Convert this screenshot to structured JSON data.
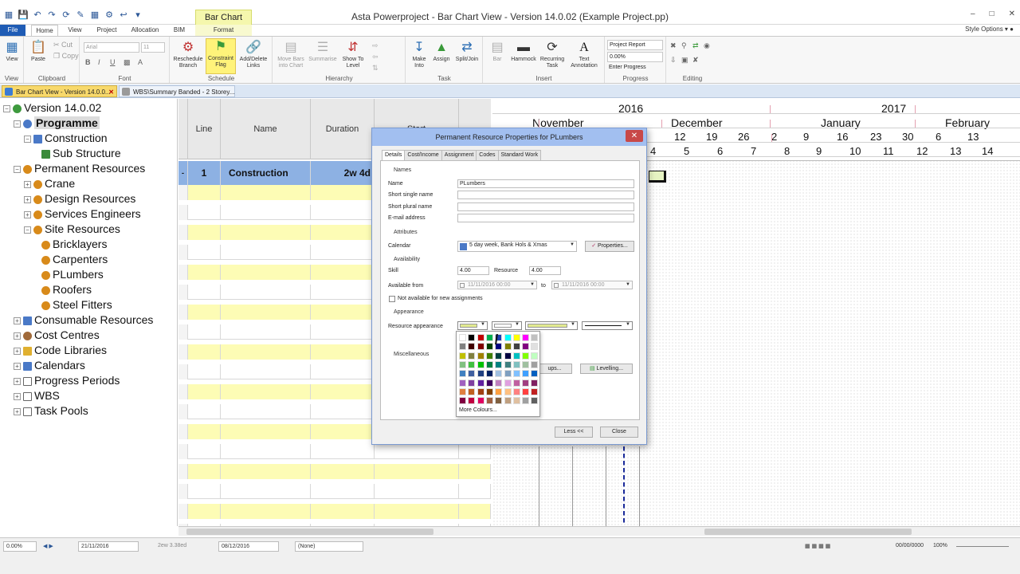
{
  "window": {
    "title": "Asta Powerproject - Bar Chart View - Version 14.0.02 (Example Project.pp)",
    "context_tools": "Bar Chart Tools",
    "controls": [
      "–",
      "□",
      "✕"
    ]
  },
  "ribbon_tabs": [
    "File",
    "Home",
    "View",
    "Project",
    "Allocation",
    "BIM",
    "Format"
  ],
  "style_options": "Style Options",
  "ribbon": {
    "view": {
      "btn": "View",
      "group": "View"
    },
    "clipboard": {
      "paste": "Paste",
      "cut": "Cut",
      "copy": "Copy",
      "group": "Clipboard"
    },
    "font": {
      "family": "Arial",
      "size": "11",
      "group": "Font",
      "bold": "B",
      "italic": "I",
      "underline": "U"
    },
    "schedule": {
      "reschedule": "Reschedule Branch",
      "constraint": "Constraint Flag",
      "add_delete": "Add/Delete Links",
      "group": "Schedule"
    },
    "hierarchy": {
      "move_bars": "Move Bars into Chart",
      "summarise": "Summarise",
      "show_to_level": "Show To Level",
      "group": "Hierarchy"
    },
    "task": {
      "make_into": "Make Into",
      "assign": "Assign",
      "split_join": "Split/Join",
      "group": "Task"
    },
    "insert": {
      "bar": "Bar",
      "hammock": "Hammock",
      "recurring": "Recurring Task",
      "text_annotation": "Text Annotation",
      "group": "Insert"
    },
    "progress": {
      "report": "Project Report",
      "percent": "0.00%",
      "enter": "Enter Progress",
      "group": "Progress"
    },
    "editing": {
      "group": "Editing"
    }
  },
  "doc_tabs": [
    {
      "label": "Bar Chart View - Version 14.0.0..."
    },
    {
      "label": "WBS\\Summary Banded - 2 Storey..."
    }
  ],
  "tree": [
    {
      "label": "Version 14.0.02",
      "icon": "globe-icon",
      "color": "#3e9a3e"
    },
    {
      "label": "Programme",
      "icon": "programme-icon",
      "color": "#4a79c7"
    },
    {
      "label": "Construction",
      "icon": "folder-icon",
      "color": "#4a79c7"
    },
    {
      "label": "Sub Structure",
      "icon": "chart-icon",
      "color": "#3a8a3a"
    },
    {
      "label": "Permanent Resources",
      "icon": "resource-icon",
      "color": "#d88a1a"
    },
    {
      "label": "Crane",
      "icon": "resource-icon",
      "color": "#d88a1a"
    },
    {
      "label": "Design Resources",
      "icon": "resource-icon",
      "color": "#d88a1a"
    },
    {
      "label": "Services Engineers",
      "icon": "resource-icon",
      "color": "#d88a1a"
    },
    {
      "label": "Site Resources",
      "icon": "resource-icon",
      "color": "#d88a1a"
    },
    {
      "label": "Bricklayers",
      "icon": "resource-icon",
      "color": "#d88a1a"
    },
    {
      "label": "Carpenters",
      "icon": "resource-icon",
      "color": "#d88a1a"
    },
    {
      "label": "PLumbers",
      "icon": "resource-icon",
      "color": "#d88a1a"
    },
    {
      "label": "Roofers",
      "icon": "resource-icon",
      "color": "#d88a1a"
    },
    {
      "label": "Steel Fitters",
      "icon": "resource-icon",
      "color": "#d88a1a"
    },
    {
      "label": "Consumable Resources",
      "icon": "consumable-icon",
      "color": "#4a79c7"
    },
    {
      "label": "Cost Centres",
      "icon": "cost-icon",
      "color": "#a06a3a"
    },
    {
      "label": "Code Libraries",
      "icon": "folder-icon",
      "color": "#e0b030"
    },
    {
      "label": "Calendars",
      "icon": "calendar-icon",
      "color": "#4a79c7"
    },
    {
      "label": "Progress Periods",
      "icon": "progress-icon",
      "color": "#666666"
    },
    {
      "label": "WBS",
      "icon": "wbs-icon",
      "color": "#666666"
    },
    {
      "label": "Task Pools",
      "icon": "pool-icon",
      "color": "#666666"
    }
  ],
  "grid": {
    "columns": [
      "Line",
      "Name",
      "Duration",
      "Start"
    ],
    "first_row": {
      "line": "1",
      "name": "Construction",
      "duration": "2w 4d"
    }
  },
  "gantt": {
    "years": [
      "2016",
      "2017"
    ],
    "months": [
      "November",
      "December",
      "January",
      "February"
    ],
    "days": [
      "12",
      "19",
      "26",
      "2",
      "9",
      "16",
      "23",
      "30",
      "6",
      "13"
    ],
    "weeks": [
      "4",
      "5",
      "6",
      "7",
      "8",
      "9",
      "10",
      "11",
      "12",
      "13",
      "14"
    ]
  },
  "dialog": {
    "title": "Permanent Resource Properties for PLumbers",
    "close": "✕",
    "tabs": [
      "Details",
      "Cost/Income",
      "Assignment",
      "Codes",
      "Standard Work"
    ],
    "names_section": "Names",
    "name_label": "Name",
    "name_value": "PLumbers",
    "short_single_label": "Short single name",
    "short_plural_label": "Short plural name",
    "email_label": "E-mail address",
    "attributes_section": "Attributes",
    "calendar_label": "Calendar",
    "calendar_value": "5 day week, Bank Hols & Xmas",
    "properties_btn": "Properties...",
    "availability_section": "Availability",
    "skill_label": "Skill",
    "skill_value": "4.00",
    "resource_label": "Resource",
    "resource_value": "4.00",
    "available_from_label": "Available from",
    "from_value": "11/11/2016 00:00",
    "to_label": "to",
    "to_value": "11/11/2016 00:00",
    "not_available_label": "Not available for new assignments",
    "appearance_section": "Appearance",
    "resource_appearance_label": "Resource appearance",
    "misc_section": "Miscellaneous",
    "groups_btn": "ups...",
    "levelling_btn": "Levelling...",
    "less_btn": "Less <<",
    "close_btn": "Close",
    "more_colours": "More Colours..."
  },
  "palette_colors": [
    [
      "#ffffff",
      "#000000",
      "#c00000",
      "#00b050",
      "#1f3fb0",
      "#00ffff",
      "#ffff00",
      "#ff00ff",
      "#c0c0c0"
    ],
    [
      "#808080",
      "#400000",
      "#800000",
      "#004000",
      "#000080",
      "#808000",
      "#404040",
      "#800080",
      "#e0e0e0"
    ],
    [
      "#c0c000",
      "#808040",
      "#a08000",
      "#408000",
      "#004040",
      "#000040",
      "#00c0c0",
      "#80ff00",
      "#c0ffc0"
    ],
    [
      "#80c080",
      "#40c040",
      "#00c000",
      "#008040",
      "#008080",
      "#408080",
      "#80c0c0",
      "#a0c0a0",
      "#a0a0a0"
    ],
    [
      "#4080c0",
      "#4060a0",
      "#204080",
      "#002060",
      "#a0c0e0",
      "#80a0c0",
      "#80c0ff",
      "#40a0ff",
      "#0060c0"
    ],
    [
      "#a060c0",
      "#8040a0",
      "#6020a0",
      "#400060",
      "#c080c0",
      "#e0a0e0",
      "#c060a0",
      "#a04080",
      "#802060"
    ],
    [
      "#e08040",
      "#c06020",
      "#a04010",
      "#804000",
      "#ffa040",
      "#ffc080",
      "#ff8080",
      "#ff4040",
      "#c02020"
    ],
    [
      "#800040",
      "#c00040",
      "#e00060",
      "#a06040",
      "#806040",
      "#c0a080",
      "#e0c0a0",
      "#a0a0a0",
      "#606060"
    ]
  ],
  "status": {
    "zoom": "0.00%",
    "date1": "21/11/2016",
    "duration": "2ew 3.38ed",
    "date2": "08/12/2016",
    "none": "(None)",
    "coords": "00/00/0000",
    "zoom_pct": "100%"
  }
}
